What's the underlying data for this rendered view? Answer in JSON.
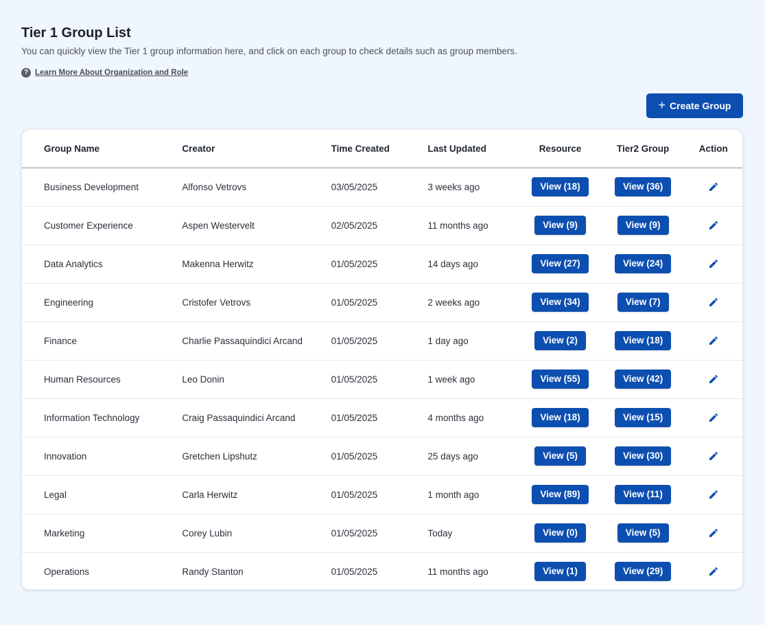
{
  "header": {
    "title": "Tier 1 Group List",
    "subtitle": "You can quickly view the Tier 1 group information here, and click on each group to check details such as group members.",
    "help_icon": "question-circle-icon",
    "help_link": "Learn More About Organization and Role"
  },
  "toolbar": {
    "create_icon": "plus-icon",
    "create_label": "Create Group"
  },
  "table": {
    "columns": {
      "name": "Group Name",
      "creator": "Creator",
      "created": "Time Created",
      "updated": "Last Updated",
      "resource": "Resource",
      "tier2": "Tier2 Group",
      "action": "Action"
    },
    "action_icon": "pencil-edit-icon",
    "rows": [
      {
        "name": "Business Development",
        "creator": "Alfonso Vetrovs",
        "created": "03/05/2025",
        "updated": "3 weeks ago",
        "resource": "View (18)",
        "tier2": "View (36)"
      },
      {
        "name": "Customer Experience",
        "creator": "Aspen Westervelt",
        "created": "02/05/2025",
        "updated": "11 months ago",
        "resource": "View (9)",
        "tier2": "View (9)"
      },
      {
        "name": "Data Analytics",
        "creator": "Makenna Herwitz",
        "created": "01/05/2025",
        "updated": "14 days ago",
        "resource": "View (27)",
        "tier2": "View (24)"
      },
      {
        "name": "Engineering",
        "creator": "Cristofer Vetrovs",
        "created": "01/05/2025",
        "updated": "2 weeks ago",
        "resource": "View (34)",
        "tier2": "View (7)"
      },
      {
        "name": "Finance",
        "creator": "Charlie Passaquindici Arcand",
        "created": "01/05/2025",
        "updated": "1 day ago",
        "resource": "View (2)",
        "tier2": "View (18)"
      },
      {
        "name": "Human Resources",
        "creator": "Leo Donin",
        "created": "01/05/2025",
        "updated": "1 week ago",
        "resource": "View (55)",
        "tier2": "View (42)"
      },
      {
        "name": "Information Technology",
        "creator": "Craig Passaquindici Arcand",
        "created": "01/05/2025",
        "updated": "4 months ago",
        "resource": "View (18)",
        "tier2": "View (15)"
      },
      {
        "name": "Innovation",
        "creator": "Gretchen Lipshutz",
        "created": "01/05/2025",
        "updated": "25 days ago",
        "resource": "View (5)",
        "tier2": "View (30)"
      },
      {
        "name": "Legal",
        "creator": "Carla Herwitz",
        "created": "01/05/2025",
        "updated": "1 month ago",
        "resource": "View (89)",
        "tier2": "View (11)"
      },
      {
        "name": "Marketing",
        "creator": "Corey Lubin",
        "created": "01/05/2025",
        "updated": "Today",
        "resource": "View (0)",
        "tier2": "View (5)"
      },
      {
        "name": "Operations",
        "creator": "Randy Stanton",
        "created": "01/05/2025",
        "updated": "11 months ago",
        "resource": "View (1)",
        "tier2": "View (29)"
      }
    ]
  },
  "colors": {
    "primary": "#0d4fb0",
    "background": "#f0f6fd",
    "card": "#ffffff"
  }
}
